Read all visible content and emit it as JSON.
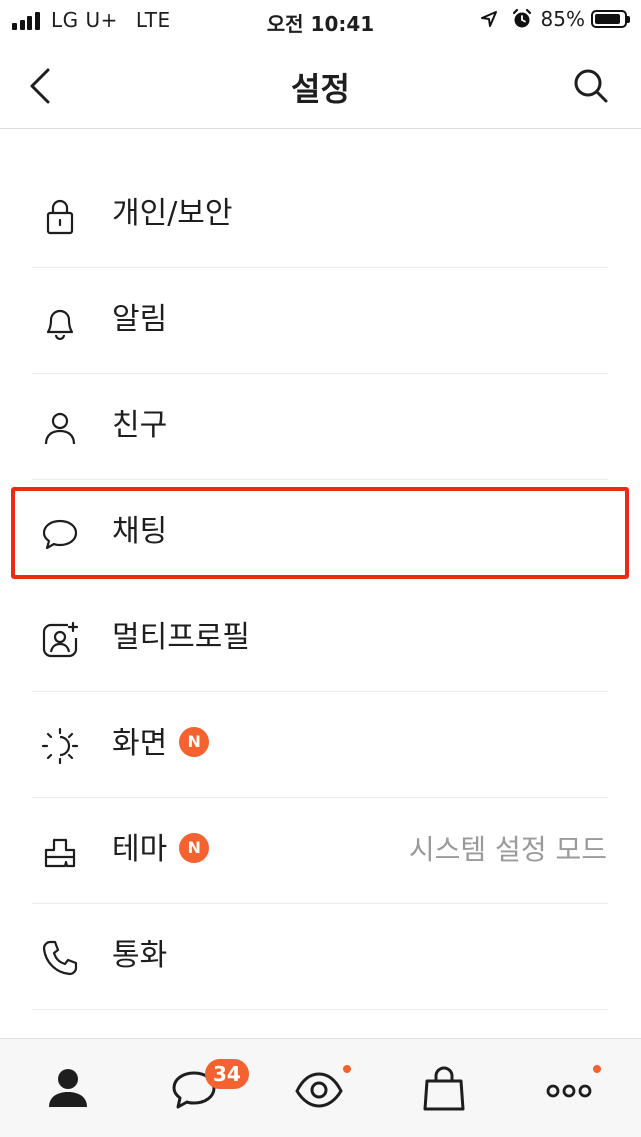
{
  "status_bar": {
    "carrier": "LG U+",
    "network": "LTE",
    "time": "오전 10:41",
    "battery": "85%",
    "battery_level": 0.85
  },
  "header": {
    "title": "설정",
    "back_icon": "chevron-left-icon",
    "search_icon": "search-icon"
  },
  "settings": {
    "items": [
      {
        "label": "개인/보안",
        "icon": "lock-icon"
      },
      {
        "label": "알림",
        "icon": "bell-icon"
      },
      {
        "label": "친구",
        "icon": "person-icon"
      },
      {
        "label": "채팅",
        "icon": "chat-bubble-icon"
      },
      {
        "label": "멀티프로필",
        "icon": "multi-profile-icon"
      },
      {
        "label": "화면",
        "icon": "display-brightness-icon",
        "badge": "N"
      },
      {
        "label": "테마",
        "icon": "theme-brush-icon",
        "badge": "N",
        "value": "시스템 설정 모드"
      },
      {
        "label": "통화",
        "icon": "phone-icon"
      }
    ]
  },
  "tabbar": {
    "tabs": [
      {
        "name": "friends",
        "icon": "person-filled-icon"
      },
      {
        "name": "chats",
        "icon": "chat-bubble-icon",
        "badge": "34"
      },
      {
        "name": "view",
        "icon": "eye-icon",
        "dot": true
      },
      {
        "name": "shopping",
        "icon": "shopping-bag-icon"
      },
      {
        "name": "more",
        "icon": "more-dots-icon",
        "dot": true
      }
    ]
  },
  "colors": {
    "accent": "#f3622f",
    "highlight_border": "#ee2b12",
    "text": "#1e1e1e",
    "secondary_text": "#9a9a9a"
  }
}
